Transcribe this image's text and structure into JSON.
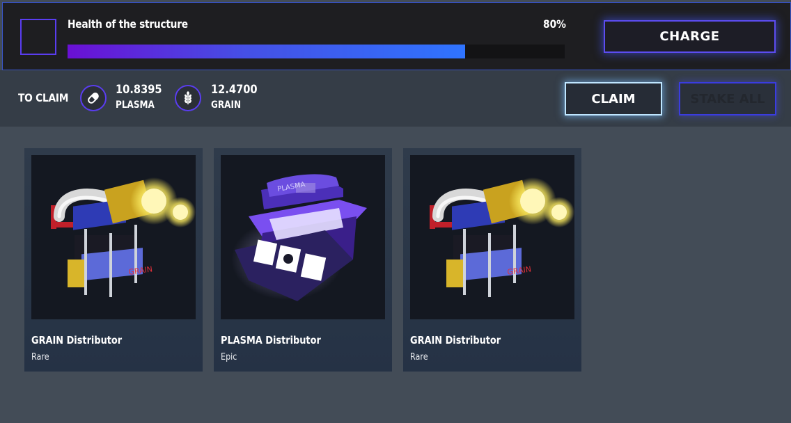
{
  "health": {
    "label": "Health of the structure",
    "percent_text": "80%",
    "value": 0.8,
    "charge_label": "CHARGE"
  },
  "claim": {
    "to_claim_label": "TO CLAIM",
    "tokens": [
      {
        "amount": "10.8395",
        "name": "PLASMA",
        "icon": "pill-icon"
      },
      {
        "amount": "12.4700",
        "name": "GRAIN",
        "icon": "wheat-icon"
      }
    ],
    "claim_label": "CLAIM",
    "stake_all_label": "STAKE ALL"
  },
  "cards": [
    {
      "title": "GRAIN Distributor",
      "rarity": "Rare",
      "image": "grain-distributor"
    },
    {
      "title": "PLASMA Distributor",
      "rarity": "Epic",
      "image": "plasma-distributor"
    },
    {
      "title": "GRAIN Distributor",
      "rarity": "Rare",
      "image": "grain-distributor"
    }
  ],
  "colors": {
    "accent_purple": "#5a3df0",
    "health_gradient_start": "#6a10d4",
    "health_gradient_end": "#2f74ff",
    "claim_glow": "#bfe6ff"
  }
}
